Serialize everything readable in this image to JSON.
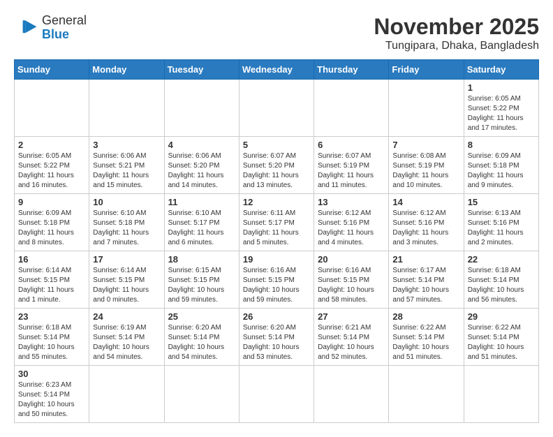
{
  "logo": {
    "general": "General",
    "blue": "Blue"
  },
  "title": "November 2025",
  "location": "Tungipara, Dhaka, Bangladesh",
  "days_of_week": [
    "Sunday",
    "Monday",
    "Tuesday",
    "Wednesday",
    "Thursday",
    "Friday",
    "Saturday"
  ],
  "weeks": [
    [
      {
        "day": "",
        "info": ""
      },
      {
        "day": "",
        "info": ""
      },
      {
        "day": "",
        "info": ""
      },
      {
        "day": "",
        "info": ""
      },
      {
        "day": "",
        "info": ""
      },
      {
        "day": "",
        "info": ""
      },
      {
        "day": "1",
        "info": "Sunrise: 6:05 AM\nSunset: 5:22 PM\nDaylight: 11 hours and 17 minutes."
      }
    ],
    [
      {
        "day": "2",
        "info": "Sunrise: 6:05 AM\nSunset: 5:22 PM\nDaylight: 11 hours and 16 minutes."
      },
      {
        "day": "3",
        "info": "Sunrise: 6:06 AM\nSunset: 5:21 PM\nDaylight: 11 hours and 15 minutes."
      },
      {
        "day": "4",
        "info": "Sunrise: 6:06 AM\nSunset: 5:20 PM\nDaylight: 11 hours and 14 minutes."
      },
      {
        "day": "5",
        "info": "Sunrise: 6:07 AM\nSunset: 5:20 PM\nDaylight: 11 hours and 13 minutes."
      },
      {
        "day": "6",
        "info": "Sunrise: 6:07 AM\nSunset: 5:19 PM\nDaylight: 11 hours and 11 minutes."
      },
      {
        "day": "7",
        "info": "Sunrise: 6:08 AM\nSunset: 5:19 PM\nDaylight: 11 hours and 10 minutes."
      },
      {
        "day": "8",
        "info": "Sunrise: 6:09 AM\nSunset: 5:18 PM\nDaylight: 11 hours and 9 minutes."
      }
    ],
    [
      {
        "day": "9",
        "info": "Sunrise: 6:09 AM\nSunset: 5:18 PM\nDaylight: 11 hours and 8 minutes."
      },
      {
        "day": "10",
        "info": "Sunrise: 6:10 AM\nSunset: 5:18 PM\nDaylight: 11 hours and 7 minutes."
      },
      {
        "day": "11",
        "info": "Sunrise: 6:10 AM\nSunset: 5:17 PM\nDaylight: 11 hours and 6 minutes."
      },
      {
        "day": "12",
        "info": "Sunrise: 6:11 AM\nSunset: 5:17 PM\nDaylight: 11 hours and 5 minutes."
      },
      {
        "day": "13",
        "info": "Sunrise: 6:12 AM\nSunset: 5:16 PM\nDaylight: 11 hours and 4 minutes."
      },
      {
        "day": "14",
        "info": "Sunrise: 6:12 AM\nSunset: 5:16 PM\nDaylight: 11 hours and 3 minutes."
      },
      {
        "day": "15",
        "info": "Sunrise: 6:13 AM\nSunset: 5:16 PM\nDaylight: 11 hours and 2 minutes."
      }
    ],
    [
      {
        "day": "16",
        "info": "Sunrise: 6:14 AM\nSunset: 5:15 PM\nDaylight: 11 hours and 1 minute."
      },
      {
        "day": "17",
        "info": "Sunrise: 6:14 AM\nSunset: 5:15 PM\nDaylight: 11 hours and 0 minutes."
      },
      {
        "day": "18",
        "info": "Sunrise: 6:15 AM\nSunset: 5:15 PM\nDaylight: 10 hours and 59 minutes."
      },
      {
        "day": "19",
        "info": "Sunrise: 6:16 AM\nSunset: 5:15 PM\nDaylight: 10 hours and 59 minutes."
      },
      {
        "day": "20",
        "info": "Sunrise: 6:16 AM\nSunset: 5:15 PM\nDaylight: 10 hours and 58 minutes."
      },
      {
        "day": "21",
        "info": "Sunrise: 6:17 AM\nSunset: 5:14 PM\nDaylight: 10 hours and 57 minutes."
      },
      {
        "day": "22",
        "info": "Sunrise: 6:18 AM\nSunset: 5:14 PM\nDaylight: 10 hours and 56 minutes."
      }
    ],
    [
      {
        "day": "23",
        "info": "Sunrise: 6:18 AM\nSunset: 5:14 PM\nDaylight: 10 hours and 55 minutes."
      },
      {
        "day": "24",
        "info": "Sunrise: 6:19 AM\nSunset: 5:14 PM\nDaylight: 10 hours and 54 minutes."
      },
      {
        "day": "25",
        "info": "Sunrise: 6:20 AM\nSunset: 5:14 PM\nDaylight: 10 hours and 54 minutes."
      },
      {
        "day": "26",
        "info": "Sunrise: 6:20 AM\nSunset: 5:14 PM\nDaylight: 10 hours and 53 minutes."
      },
      {
        "day": "27",
        "info": "Sunrise: 6:21 AM\nSunset: 5:14 PM\nDaylight: 10 hours and 52 minutes."
      },
      {
        "day": "28",
        "info": "Sunrise: 6:22 AM\nSunset: 5:14 PM\nDaylight: 10 hours and 51 minutes."
      },
      {
        "day": "29",
        "info": "Sunrise: 6:22 AM\nSunset: 5:14 PM\nDaylight: 10 hours and 51 minutes."
      }
    ],
    [
      {
        "day": "30",
        "info": "Sunrise: 6:23 AM\nSunset: 5:14 PM\nDaylight: 10 hours and 50 minutes."
      },
      {
        "day": "",
        "info": ""
      },
      {
        "day": "",
        "info": ""
      },
      {
        "day": "",
        "info": ""
      },
      {
        "day": "",
        "info": ""
      },
      {
        "day": "",
        "info": ""
      },
      {
        "day": "",
        "info": ""
      }
    ]
  ]
}
